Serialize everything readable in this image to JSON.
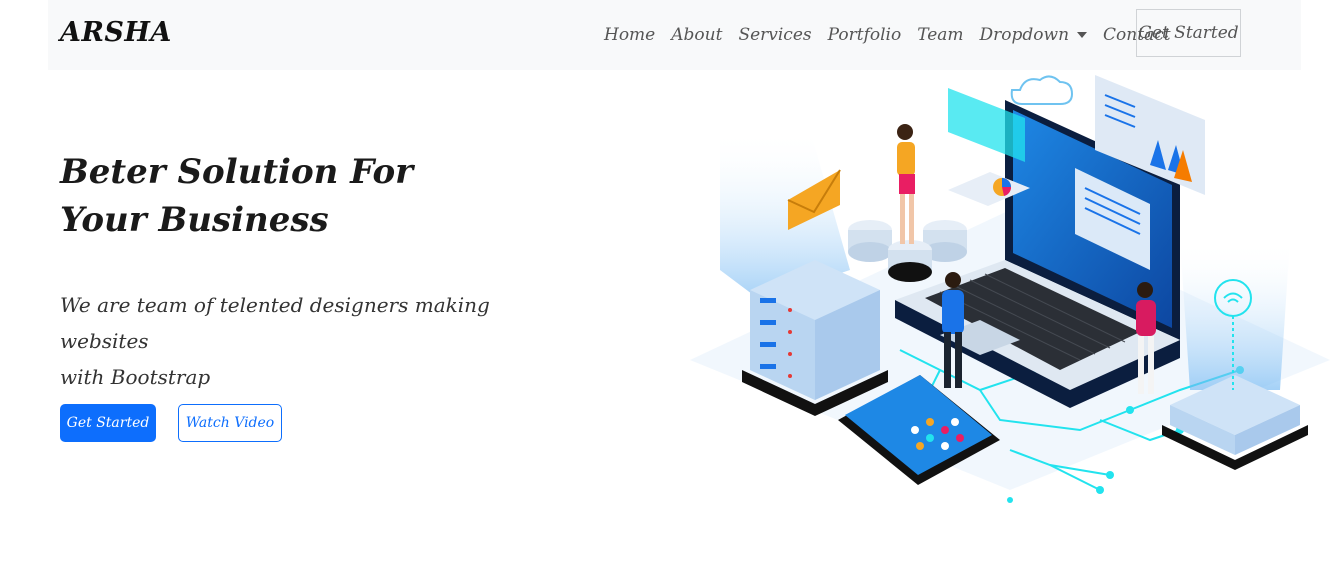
{
  "brand": "ARSHA",
  "nav": {
    "links": [
      "Home",
      "About",
      "Services",
      "Portfolio",
      "Team",
      "Dropdown",
      "Contact"
    ],
    "cta": "Get Started"
  },
  "hero": {
    "title_line1": "Beter Solution For",
    "title_line2": "Your Business",
    "subtitle_line1": "We are team of telented designers making websites",
    "subtitle_line2": "with Bootstrap",
    "primary_button": "Get Started",
    "secondary_button": "Watch Video"
  },
  "colors": {
    "accent": "#0d6efd",
    "navbar_bg": "#f8f9fa",
    "illustration_blue": "#1a73e8",
    "illustration_cyan": "#22e3ee"
  },
  "icons": [
    "dropdown-caret-icon",
    "hero-illustration"
  ]
}
